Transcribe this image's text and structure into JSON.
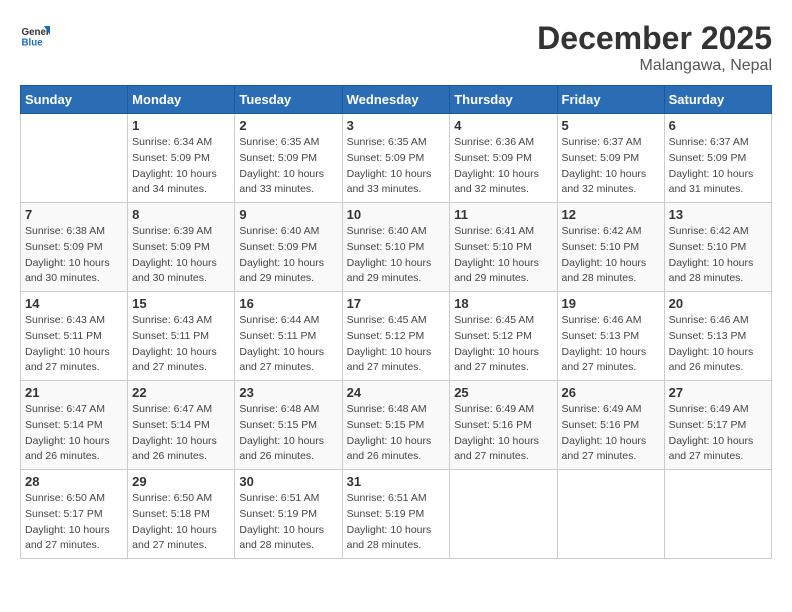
{
  "logo": {
    "general": "General",
    "blue": "Blue"
  },
  "title": {
    "month": "December 2025",
    "location": "Malangawa, Nepal"
  },
  "days_of_week": [
    "Sunday",
    "Monday",
    "Tuesday",
    "Wednesday",
    "Thursday",
    "Friday",
    "Saturday"
  ],
  "weeks": [
    [
      {
        "day": "",
        "sunrise": "",
        "sunset": "",
        "daylight": ""
      },
      {
        "day": "1",
        "sunrise": "Sunrise: 6:34 AM",
        "sunset": "Sunset: 5:09 PM",
        "daylight": "Daylight: 10 hours and 34 minutes."
      },
      {
        "day": "2",
        "sunrise": "Sunrise: 6:35 AM",
        "sunset": "Sunset: 5:09 PM",
        "daylight": "Daylight: 10 hours and 33 minutes."
      },
      {
        "day": "3",
        "sunrise": "Sunrise: 6:35 AM",
        "sunset": "Sunset: 5:09 PM",
        "daylight": "Daylight: 10 hours and 33 minutes."
      },
      {
        "day": "4",
        "sunrise": "Sunrise: 6:36 AM",
        "sunset": "Sunset: 5:09 PM",
        "daylight": "Daylight: 10 hours and 32 minutes."
      },
      {
        "day": "5",
        "sunrise": "Sunrise: 6:37 AM",
        "sunset": "Sunset: 5:09 PM",
        "daylight": "Daylight: 10 hours and 32 minutes."
      },
      {
        "day": "6",
        "sunrise": "Sunrise: 6:37 AM",
        "sunset": "Sunset: 5:09 PM",
        "daylight": "Daylight: 10 hours and 31 minutes."
      }
    ],
    [
      {
        "day": "7",
        "sunrise": "Sunrise: 6:38 AM",
        "sunset": "Sunset: 5:09 PM",
        "daylight": "Daylight: 10 hours and 30 minutes."
      },
      {
        "day": "8",
        "sunrise": "Sunrise: 6:39 AM",
        "sunset": "Sunset: 5:09 PM",
        "daylight": "Daylight: 10 hours and 30 minutes."
      },
      {
        "day": "9",
        "sunrise": "Sunrise: 6:40 AM",
        "sunset": "Sunset: 5:09 PM",
        "daylight": "Daylight: 10 hours and 29 minutes."
      },
      {
        "day": "10",
        "sunrise": "Sunrise: 6:40 AM",
        "sunset": "Sunset: 5:10 PM",
        "daylight": "Daylight: 10 hours and 29 minutes."
      },
      {
        "day": "11",
        "sunrise": "Sunrise: 6:41 AM",
        "sunset": "Sunset: 5:10 PM",
        "daylight": "Daylight: 10 hours and 29 minutes."
      },
      {
        "day": "12",
        "sunrise": "Sunrise: 6:42 AM",
        "sunset": "Sunset: 5:10 PM",
        "daylight": "Daylight: 10 hours and 28 minutes."
      },
      {
        "day": "13",
        "sunrise": "Sunrise: 6:42 AM",
        "sunset": "Sunset: 5:10 PM",
        "daylight": "Daylight: 10 hours and 28 minutes."
      }
    ],
    [
      {
        "day": "14",
        "sunrise": "Sunrise: 6:43 AM",
        "sunset": "Sunset: 5:11 PM",
        "daylight": "Daylight: 10 hours and 27 minutes."
      },
      {
        "day": "15",
        "sunrise": "Sunrise: 6:43 AM",
        "sunset": "Sunset: 5:11 PM",
        "daylight": "Daylight: 10 hours and 27 minutes."
      },
      {
        "day": "16",
        "sunrise": "Sunrise: 6:44 AM",
        "sunset": "Sunset: 5:11 PM",
        "daylight": "Daylight: 10 hours and 27 minutes."
      },
      {
        "day": "17",
        "sunrise": "Sunrise: 6:45 AM",
        "sunset": "Sunset: 5:12 PM",
        "daylight": "Daylight: 10 hours and 27 minutes."
      },
      {
        "day": "18",
        "sunrise": "Sunrise: 6:45 AM",
        "sunset": "Sunset: 5:12 PM",
        "daylight": "Daylight: 10 hours and 27 minutes."
      },
      {
        "day": "19",
        "sunrise": "Sunrise: 6:46 AM",
        "sunset": "Sunset: 5:13 PM",
        "daylight": "Daylight: 10 hours and 27 minutes."
      },
      {
        "day": "20",
        "sunrise": "Sunrise: 6:46 AM",
        "sunset": "Sunset: 5:13 PM",
        "daylight": "Daylight: 10 hours and 26 minutes."
      }
    ],
    [
      {
        "day": "21",
        "sunrise": "Sunrise: 6:47 AM",
        "sunset": "Sunset: 5:14 PM",
        "daylight": "Daylight: 10 hours and 26 minutes."
      },
      {
        "day": "22",
        "sunrise": "Sunrise: 6:47 AM",
        "sunset": "Sunset: 5:14 PM",
        "daylight": "Daylight: 10 hours and 26 minutes."
      },
      {
        "day": "23",
        "sunrise": "Sunrise: 6:48 AM",
        "sunset": "Sunset: 5:15 PM",
        "daylight": "Daylight: 10 hours and 26 minutes."
      },
      {
        "day": "24",
        "sunrise": "Sunrise: 6:48 AM",
        "sunset": "Sunset: 5:15 PM",
        "daylight": "Daylight: 10 hours and 26 minutes."
      },
      {
        "day": "25",
        "sunrise": "Sunrise: 6:49 AM",
        "sunset": "Sunset: 5:16 PM",
        "daylight": "Daylight: 10 hours and 27 minutes."
      },
      {
        "day": "26",
        "sunrise": "Sunrise: 6:49 AM",
        "sunset": "Sunset: 5:16 PM",
        "daylight": "Daylight: 10 hours and 27 minutes."
      },
      {
        "day": "27",
        "sunrise": "Sunrise: 6:49 AM",
        "sunset": "Sunset: 5:17 PM",
        "daylight": "Daylight: 10 hours and 27 minutes."
      }
    ],
    [
      {
        "day": "28",
        "sunrise": "Sunrise: 6:50 AM",
        "sunset": "Sunset: 5:17 PM",
        "daylight": "Daylight: 10 hours and 27 minutes."
      },
      {
        "day": "29",
        "sunrise": "Sunrise: 6:50 AM",
        "sunset": "Sunset: 5:18 PM",
        "daylight": "Daylight: 10 hours and 27 minutes."
      },
      {
        "day": "30",
        "sunrise": "Sunrise: 6:51 AM",
        "sunset": "Sunset: 5:19 PM",
        "daylight": "Daylight: 10 hours and 28 minutes."
      },
      {
        "day": "31",
        "sunrise": "Sunrise: 6:51 AM",
        "sunset": "Sunset: 5:19 PM",
        "daylight": "Daylight: 10 hours and 28 minutes."
      },
      {
        "day": "",
        "sunrise": "",
        "sunset": "",
        "daylight": ""
      },
      {
        "day": "",
        "sunrise": "",
        "sunset": "",
        "daylight": ""
      },
      {
        "day": "",
        "sunrise": "",
        "sunset": "",
        "daylight": ""
      }
    ]
  ]
}
